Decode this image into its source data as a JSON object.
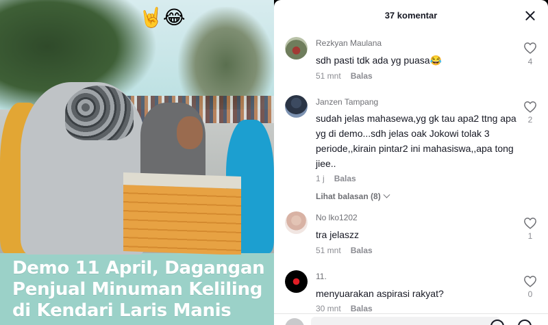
{
  "video": {
    "caption": "Demo 11 April, Dagangan Penjual Minuman Keliling di Kendari Laris Manis",
    "overlay_emoji": "🤘😂"
  },
  "comments_panel": {
    "title": "37 komentar",
    "reply_label": "Balas",
    "view_replies_label": "Lihat balasan (8)",
    "comments": [
      {
        "username": "Rezkyan Maulana",
        "text": "sdh pasti tdk ada yg puasa😂",
        "time": "51 mnt",
        "likes": "4",
        "avatar_icon": "user-avatar"
      },
      {
        "username": "Janzen Tampang",
        "text": "sudah jelas mahasewa,yg gk tau apa2 ttng apa yg di demo...sdh jelas oak Jokowi tolak 3 periode,,kirain pintar2 ini mahasiswa,,apa tong jiee..",
        "time": "1 j",
        "likes": "2",
        "avatar_icon": "user-avatar"
      },
      {
        "username": "No lko1202",
        "text": "tra jelaszz",
        "time": "51 mnt",
        "likes": "1",
        "avatar_icon": "user-avatar"
      },
      {
        "username": "11.",
        "text": "menyuarakan aspirasi rakyat?",
        "time": "30 mnt",
        "likes": "0",
        "avatar_icon": "user-avatar"
      }
    ]
  },
  "colors": {
    "panel_bg": "#ffffff",
    "text_primary": "#161823",
    "text_secondary": "#8a8b91",
    "caption_bg": "#9bd1c8"
  }
}
